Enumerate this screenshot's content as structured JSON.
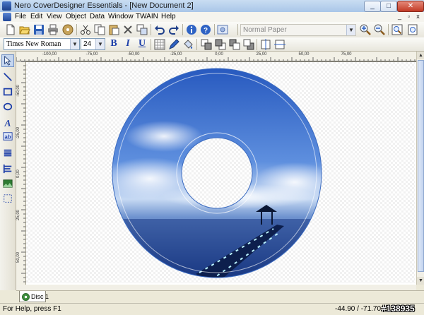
{
  "window": {
    "title": "Nero CoverDesigner Essentials - [New Document 2]",
    "minimize": "_",
    "maximize": "□",
    "close": "✕"
  },
  "menu": {
    "items": [
      "File",
      "Edit",
      "View",
      "Object",
      "Data",
      "Window",
      "TWAIN",
      "Help"
    ],
    "mdi_minimize": "_",
    "mdi_restore": "▫",
    "mdi_close": "x"
  },
  "toolbar": {
    "paper_select": "Normal Paper",
    "font_family": "Times New Roman",
    "font_size": "24",
    "bold": "B",
    "italic": "I",
    "underline": "U"
  },
  "rulers": {
    "horizontal": [
      "-100,00",
      "-75,00",
      "-50,00",
      "-25,00",
      "0,00",
      "25,00",
      "50,00",
      "75,00"
    ],
    "vertical": [
      "-50,00",
      "-25,00",
      "0,00",
      "25,00",
      "50,00"
    ]
  },
  "tabs": {
    "disc": "Disc 1"
  },
  "status": {
    "help": "For Help, press F1",
    "coords": "-44.90 / -71.70"
  },
  "watermark": "#138935",
  "colors": {
    "accent": "#2f63c4",
    "sky_top": "#2a63c8",
    "sky_bottom": "#9fc1ec"
  }
}
